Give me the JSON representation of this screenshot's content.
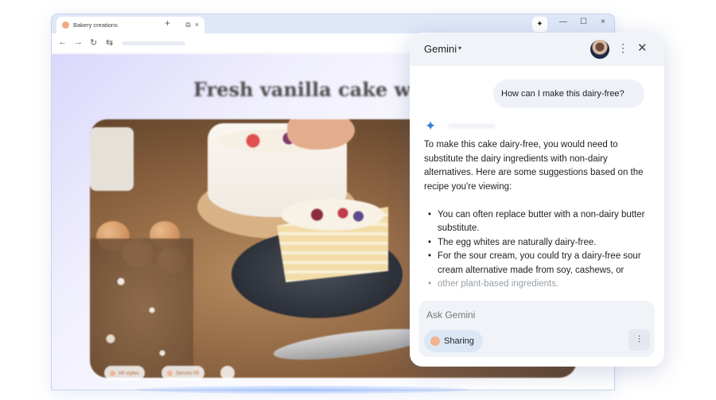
{
  "browser": {
    "tab_title": "Bakery creations",
    "tab_actions": [
      "⧉",
      "×"
    ],
    "new_tab": "+",
    "toolbar_spark": "✦",
    "window_controls": [
      "—",
      "☐",
      "×"
    ],
    "nav": [
      "←",
      "→",
      "↻",
      "⇆"
    ]
  },
  "page": {
    "headline": "Fresh vanilla cake with l",
    "chips": [
      "All styles",
      "Serves 05"
    ]
  },
  "gemini": {
    "title": "Gemini",
    "title_caret": "▾",
    "menu_icon": "⋮",
    "close_icon": "✕",
    "user_message": "How can I make this dairy-free?",
    "spark_icon": "✦",
    "answer_intro": "To make this cake dairy-free, you would need to substitute the dairy ingredients with non-dairy alternatives. Here are some suggestions based on the recipe you're viewing:",
    "answer_bullets": [
      "You can often replace butter with a non-dairy butter substitute.",
      "The egg whites are naturally dairy-free.",
      "For the sour cream, you could try a dairy-free sour cream alternative made from soy, cashews, or",
      "other plant-based ingredients."
    ],
    "input_placeholder": "Ask Gemini",
    "sharing_label": "Sharing",
    "mic_icon": "⫶"
  }
}
